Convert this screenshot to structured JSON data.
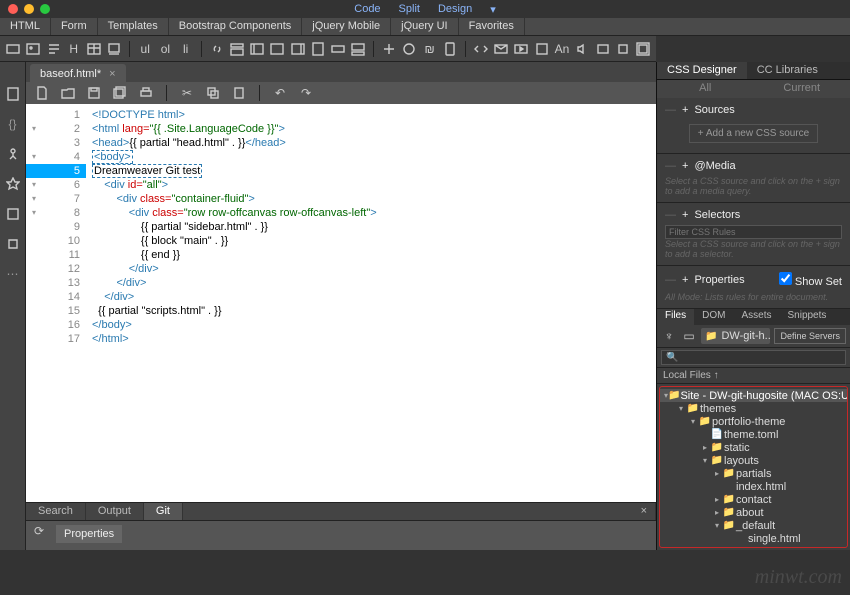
{
  "view_modes": [
    "Code",
    "Split",
    "Design"
  ],
  "menubar": [
    "HTML",
    "Form",
    "Templates",
    "Bootstrap Components",
    "jQuery Mobile",
    "jQuery UI",
    "Favorites"
  ],
  "toolbar_text": [
    "ul",
    "ol",
    "li"
  ],
  "tab": {
    "name": "baseof.html*",
    "close": "×"
  },
  "code": {
    "l1a": "<!DOCTYPE html>",
    "l2a": "<html ",
    "l2b": "lang=",
    "l2c": "\"{{ .Site.LanguageCode }}\"",
    "l2d": ">",
    "l3a": "<head>",
    "l3b": "{{ partial \"head.html\" . }}",
    "l3c": "</head>",
    "l4a": "<body>",
    "l5": "Dreamweaver Git test",
    "l6a": "<div ",
    "l6b": "id=",
    "l6c": "\"all\"",
    "l6d": ">",
    "l7a": "<div ",
    "l7b": "class=",
    "l7c": "\"container-fluid\"",
    "l7d": ">",
    "l8a": "<div ",
    "l8b": "class=",
    "l8c": "\"row row-offcanvas row-offcanvas-left\"",
    "l8d": ">",
    "l9": "{{ partial \"sidebar.html\" . }}",
    "l10": "{{ block \"main\" . }}",
    "l11": "{{ end }}",
    "l12": "</div>",
    "l13": "</div>",
    "l14": "</div>",
    "l15": "{{ partial \"scripts.html\" . }}",
    "l16": "</body>",
    "l17": "</html>"
  },
  "bottom_tabs": [
    "Search",
    "Output",
    "Git"
  ],
  "props_tab": "Properties",
  "css_panel": {
    "tabs": [
      "CSS Designer",
      "CC Libraries"
    ],
    "subtabs": [
      "All",
      "Current"
    ],
    "sources": "Sources",
    "add_source": "+ Add a new CSS source",
    "media": "@Media",
    "media_hint": "Select a CSS source and click on the + sign to add a media query.",
    "selectors": "Selectors",
    "filter_ph": "Filter CSS Rules",
    "sel_hint": "Select a CSS source and click on the + sign to add a selector.",
    "properties": "Properties",
    "show_set": "Show Set",
    "prop_hint": "All Mode: Lists rules for entire document."
  },
  "files": {
    "tabs": [
      "Files",
      "DOM",
      "Assets",
      "Snippets"
    ],
    "site_label": "DW-git-h...",
    "define": "Define Servers",
    "local": "Local Files ↑",
    "tree": [
      {
        "d": 0,
        "t": "tw",
        "open": true,
        "ico": "📁",
        "label": "Site - DW-git-hugosite (MAC OS:Users:..",
        "sel": true
      },
      {
        "d": 1,
        "t": "tw",
        "open": true,
        "ico": "📁",
        "label": "themes"
      },
      {
        "d": 2,
        "t": "tw",
        "open": true,
        "ico": "📁",
        "label": "portfolio-theme"
      },
      {
        "d": 3,
        "t": "",
        "ico": "📄",
        "label": "theme.toml"
      },
      {
        "d": 3,
        "t": "tw",
        "open": false,
        "ico": "📁",
        "label": "static"
      },
      {
        "d": 3,
        "t": "tw",
        "open": true,
        "ico": "📁",
        "label": "layouts"
      },
      {
        "d": 4,
        "t": "tw",
        "open": false,
        "ico": "📁",
        "label": "partials"
      },
      {
        "d": 4,
        "t": "",
        "ico": "</>",
        "label": "index.html"
      },
      {
        "d": 4,
        "t": "tw",
        "open": false,
        "ico": "📁",
        "label": "contact"
      },
      {
        "d": 4,
        "t": "tw",
        "open": false,
        "ico": "📁",
        "label": "about"
      },
      {
        "d": 4,
        "t": "tw",
        "open": true,
        "ico": "📁",
        "label": "_default"
      },
      {
        "d": 5,
        "t": "",
        "ico": "</>",
        "label": "single.html"
      }
    ]
  },
  "watermark": "minwt.com"
}
